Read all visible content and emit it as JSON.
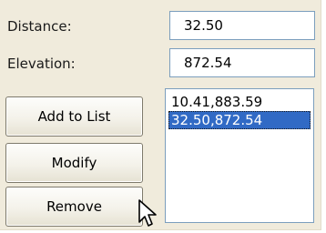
{
  "labels": {
    "distance": "Distance:",
    "elevation": "Elevation:"
  },
  "fields": {
    "distance_value": "32.50",
    "elevation_value": "872.54"
  },
  "buttons": {
    "add": "Add to List",
    "modify": "Modify",
    "remove": "Remove"
  },
  "list": {
    "items": [
      "10.41,883.59",
      "32.50,872.54"
    ],
    "selected_index": 1
  },
  "colors": {
    "panel_bg": "#f0ebdc",
    "selection": "#316ac5",
    "field_border": "#7b9ebd"
  },
  "icons": {
    "cursor": "mouse-pointer-icon"
  }
}
